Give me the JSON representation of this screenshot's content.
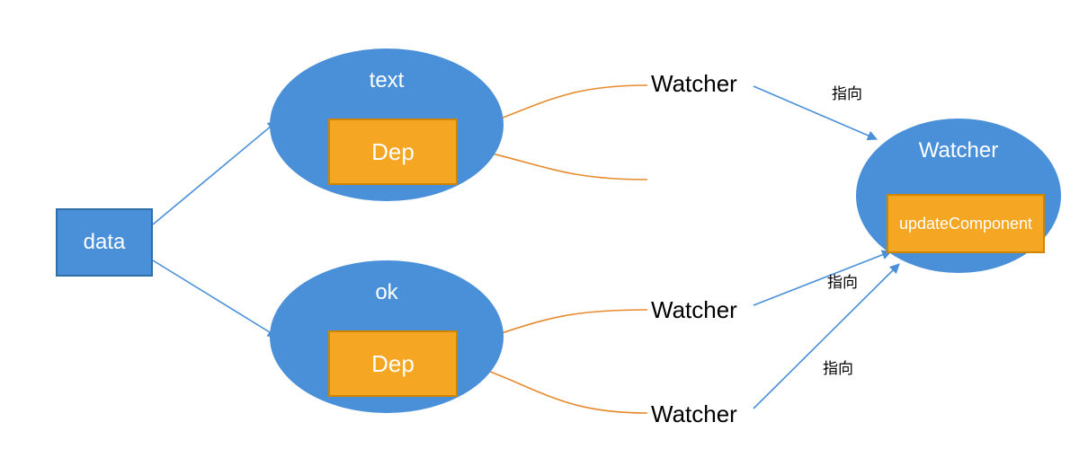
{
  "nodes": {
    "data": {
      "label": "data"
    },
    "textEllipse": {
      "title": "text",
      "depLabel": "Dep"
    },
    "okEllipse": {
      "title": "ok",
      "depLabel": "Dep"
    },
    "watcherEllipse": {
      "title": "Watcher",
      "boxLabel": "updateComponent"
    }
  },
  "watchers": {
    "w1": "Watcher",
    "w2": "Watcher",
    "w3": "Watcher"
  },
  "pointingLabels": {
    "p1": "指向",
    "p2": "指向",
    "p3": "指向"
  },
  "colors": {
    "blueFill": "#4A90D9",
    "blueBorder": "#2F6FA3",
    "orangeFill": "#F5A623",
    "orangeBorder": "#D08400",
    "arrowBlue": "#4A90D9",
    "connectorOrange": "#E78A2E"
  }
}
